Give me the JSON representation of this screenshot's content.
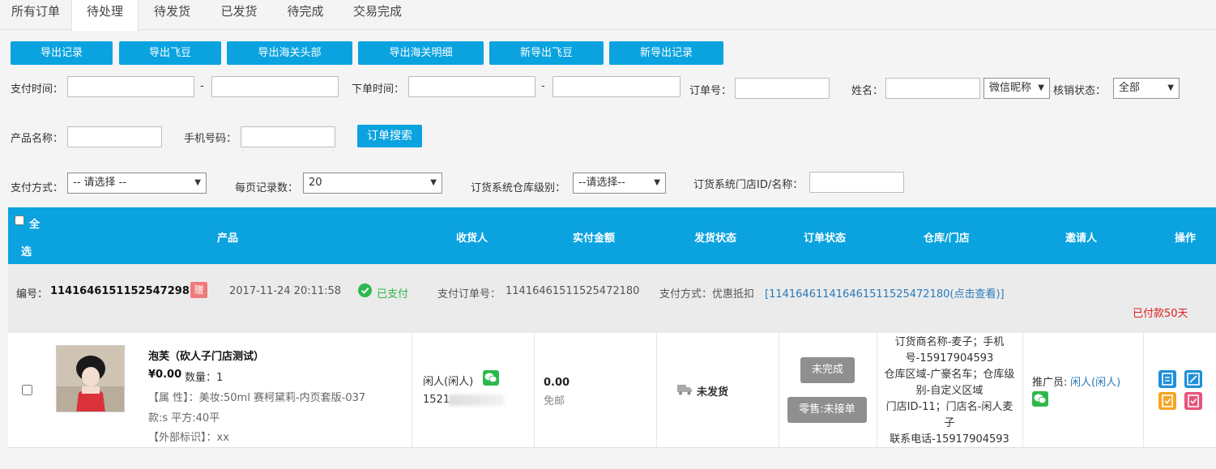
{
  "tabs": [
    "所有订单",
    "待处理",
    "待发货",
    "已发货",
    "待完成",
    "交易完成"
  ],
  "export_buttons": [
    "导出记录",
    "导出飞豆",
    "导出海关头部",
    "导出海关明细",
    "新导出飞豆",
    "新导出记录"
  ],
  "filters": {
    "pay_time_label": "支付时间：",
    "dash": "-",
    "order_time_label": "下单时间：",
    "order_no_label": "订单号：",
    "name_label": "姓名：",
    "name_type_selected": "微信昵称",
    "verify_status_label": "核销状态：",
    "verify_status_selected": "全部",
    "product_name_label": "产品名称：",
    "phone_label": "手机号码：",
    "search_button": "订单搜索",
    "pay_method_label": "支付方式：",
    "pay_method_selected": "-- 请选择 --",
    "page_size_label": "每页记录数：",
    "page_size_selected": "20",
    "warehouse_level_label": "订货系统仓库级别：",
    "warehouse_level_selected": "--请选择--",
    "store_label": "订货系统门店ID/名称："
  },
  "table_header": {
    "select_all_1": "全",
    "select_all_2": "选",
    "product": "产品",
    "receiver": "收货人",
    "paid_amount": "实付金额",
    "ship_status": "发货状态",
    "order_status": "订单状态",
    "warehouse": "仓库/门店",
    "inviter": "邀请人",
    "operation": "操作"
  },
  "order": {
    "number_label": "编号：",
    "number": "1141646151152547298 40",
    "gift_badge": "赠",
    "time": "2017-11-24 20:11:58",
    "paid_status": "已支付",
    "pay_order_label": "支付订单号：",
    "pay_order_no": "11416461511525472180",
    "pay_method_text": "支付方式：优惠抵扣",
    "pay_method_link": "[114164611416461511525472180(点击查看)]",
    "paid_days": "已付款50天",
    "product_name": "泡芙（砍人子门店测试）",
    "price": "¥0.00",
    "qty": "数量：1",
    "attr": "【属 性】：美妆:50ml 赛柯黛莉-内页套版-037",
    "attr2": "款:s 平方:40平",
    "external_id": "【外部标识】：xx",
    "receiver_name": "闲人(闲人)",
    "receiver_phone": "1521",
    "amount": "0.00",
    "shipping_free": "免邮",
    "ship_status": "未发货",
    "order_status_btn": "未完成",
    "retail_btn": "零售:未接单",
    "warehouse_info": [
      "订货商名称-麦子；手机",
      "号-15917904593",
      "仓库区域-广豪名车；仓库级",
      "别-自定义区域",
      "门店ID-11；门店名-闲人麦",
      "子",
      "联系电话-15917904593"
    ],
    "promoter_label": "推广员:",
    "promoter_name": "闲人(闲人)"
  },
  "colors": {
    "accent": "#0aa3e0",
    "paid_green": "#2db84d",
    "red": "#d9201e",
    "link": "#2a7ab8"
  }
}
